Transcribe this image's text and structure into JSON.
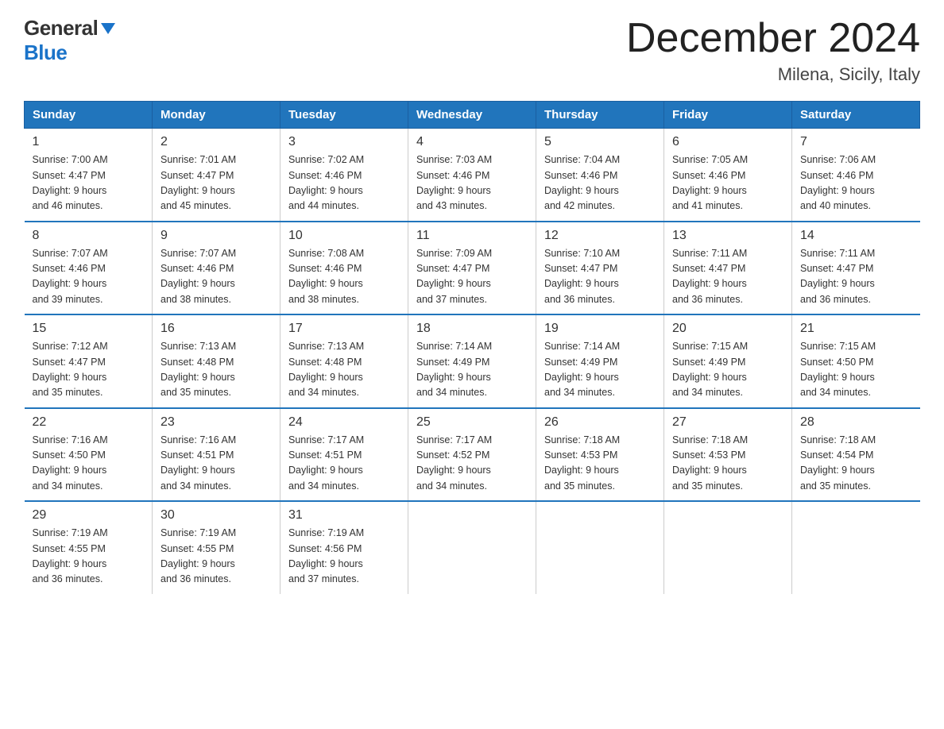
{
  "logo": {
    "general": "General",
    "blue": "Blue"
  },
  "title": "December 2024",
  "location": "Milena, Sicily, Italy",
  "headers": [
    "Sunday",
    "Monday",
    "Tuesday",
    "Wednesday",
    "Thursday",
    "Friday",
    "Saturday"
  ],
  "weeks": [
    [
      {
        "day": "1",
        "sunrise": "7:00 AM",
        "sunset": "4:47 PM",
        "daylight": "9 hours and 46 minutes."
      },
      {
        "day": "2",
        "sunrise": "7:01 AM",
        "sunset": "4:47 PM",
        "daylight": "9 hours and 45 minutes."
      },
      {
        "day": "3",
        "sunrise": "7:02 AM",
        "sunset": "4:46 PM",
        "daylight": "9 hours and 44 minutes."
      },
      {
        "day": "4",
        "sunrise": "7:03 AM",
        "sunset": "4:46 PM",
        "daylight": "9 hours and 43 minutes."
      },
      {
        "day": "5",
        "sunrise": "7:04 AM",
        "sunset": "4:46 PM",
        "daylight": "9 hours and 42 minutes."
      },
      {
        "day": "6",
        "sunrise": "7:05 AM",
        "sunset": "4:46 PM",
        "daylight": "9 hours and 41 minutes."
      },
      {
        "day": "7",
        "sunrise": "7:06 AM",
        "sunset": "4:46 PM",
        "daylight": "9 hours and 40 minutes."
      }
    ],
    [
      {
        "day": "8",
        "sunrise": "7:07 AM",
        "sunset": "4:46 PM",
        "daylight": "9 hours and 39 minutes."
      },
      {
        "day": "9",
        "sunrise": "7:07 AM",
        "sunset": "4:46 PM",
        "daylight": "9 hours and 38 minutes."
      },
      {
        "day": "10",
        "sunrise": "7:08 AM",
        "sunset": "4:46 PM",
        "daylight": "9 hours and 38 minutes."
      },
      {
        "day": "11",
        "sunrise": "7:09 AM",
        "sunset": "4:47 PM",
        "daylight": "9 hours and 37 minutes."
      },
      {
        "day": "12",
        "sunrise": "7:10 AM",
        "sunset": "4:47 PM",
        "daylight": "9 hours and 36 minutes."
      },
      {
        "day": "13",
        "sunrise": "7:11 AM",
        "sunset": "4:47 PM",
        "daylight": "9 hours and 36 minutes."
      },
      {
        "day": "14",
        "sunrise": "7:11 AM",
        "sunset": "4:47 PM",
        "daylight": "9 hours and 36 minutes."
      }
    ],
    [
      {
        "day": "15",
        "sunrise": "7:12 AM",
        "sunset": "4:47 PM",
        "daylight": "9 hours and 35 minutes."
      },
      {
        "day": "16",
        "sunrise": "7:13 AM",
        "sunset": "4:48 PM",
        "daylight": "9 hours and 35 minutes."
      },
      {
        "day": "17",
        "sunrise": "7:13 AM",
        "sunset": "4:48 PM",
        "daylight": "9 hours and 34 minutes."
      },
      {
        "day": "18",
        "sunrise": "7:14 AM",
        "sunset": "4:49 PM",
        "daylight": "9 hours and 34 minutes."
      },
      {
        "day": "19",
        "sunrise": "7:14 AM",
        "sunset": "4:49 PM",
        "daylight": "9 hours and 34 minutes."
      },
      {
        "day": "20",
        "sunrise": "7:15 AM",
        "sunset": "4:49 PM",
        "daylight": "9 hours and 34 minutes."
      },
      {
        "day": "21",
        "sunrise": "7:15 AM",
        "sunset": "4:50 PM",
        "daylight": "9 hours and 34 minutes."
      }
    ],
    [
      {
        "day": "22",
        "sunrise": "7:16 AM",
        "sunset": "4:50 PM",
        "daylight": "9 hours and 34 minutes."
      },
      {
        "day": "23",
        "sunrise": "7:16 AM",
        "sunset": "4:51 PM",
        "daylight": "9 hours and 34 minutes."
      },
      {
        "day": "24",
        "sunrise": "7:17 AM",
        "sunset": "4:51 PM",
        "daylight": "9 hours and 34 minutes."
      },
      {
        "day": "25",
        "sunrise": "7:17 AM",
        "sunset": "4:52 PM",
        "daylight": "9 hours and 34 minutes."
      },
      {
        "day": "26",
        "sunrise": "7:18 AM",
        "sunset": "4:53 PM",
        "daylight": "9 hours and 35 minutes."
      },
      {
        "day": "27",
        "sunrise": "7:18 AM",
        "sunset": "4:53 PM",
        "daylight": "9 hours and 35 minutes."
      },
      {
        "day": "28",
        "sunrise": "7:18 AM",
        "sunset": "4:54 PM",
        "daylight": "9 hours and 35 minutes."
      }
    ],
    [
      {
        "day": "29",
        "sunrise": "7:19 AM",
        "sunset": "4:55 PM",
        "daylight": "9 hours and 36 minutes."
      },
      {
        "day": "30",
        "sunrise": "7:19 AM",
        "sunset": "4:55 PM",
        "daylight": "9 hours and 36 minutes."
      },
      {
        "day": "31",
        "sunrise": "7:19 AM",
        "sunset": "4:56 PM",
        "daylight": "9 hours and 37 minutes."
      },
      null,
      null,
      null,
      null
    ]
  ]
}
